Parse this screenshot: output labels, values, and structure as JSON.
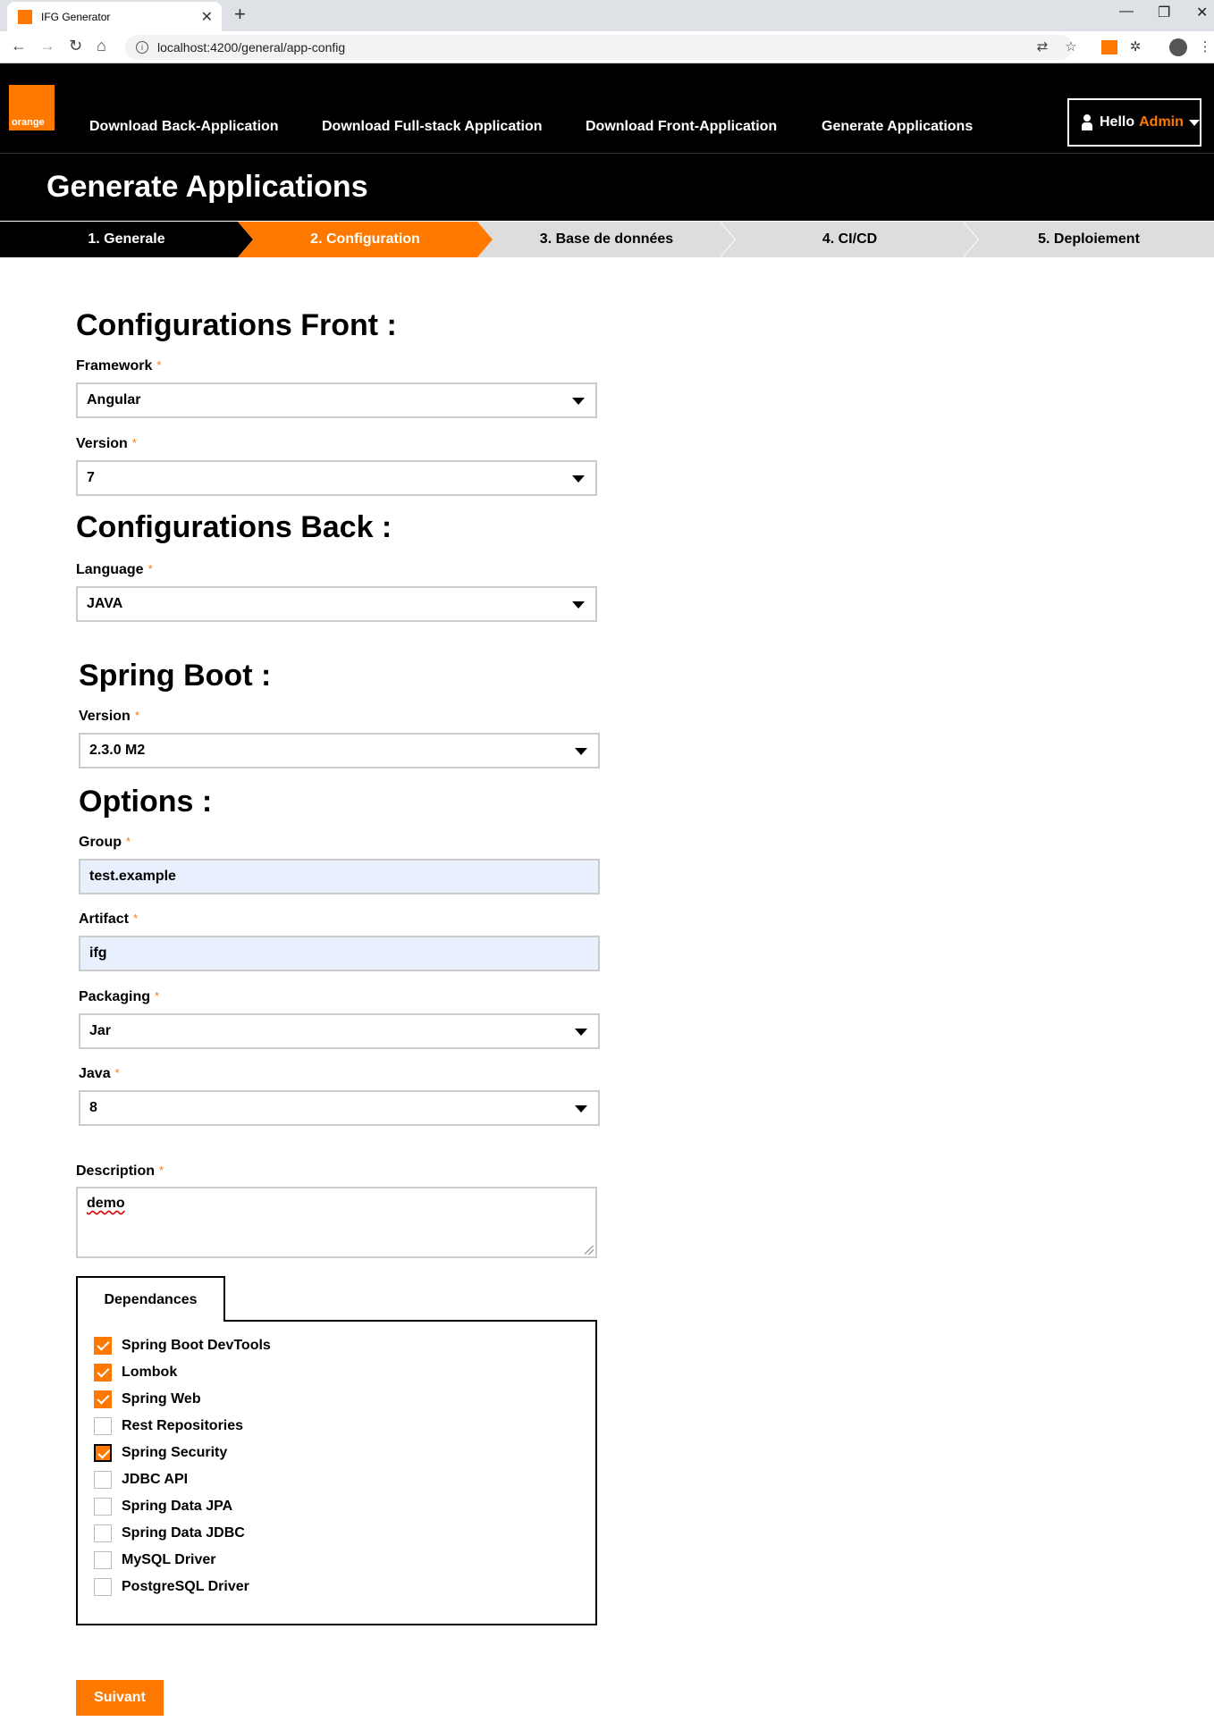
{
  "browser": {
    "tab_title": "IFG Generator",
    "url": "localhost:4200/general/app-config"
  },
  "header": {
    "logo_text": "orange",
    "nav": [
      "Download Back-Application",
      "Download Full-stack Application",
      "Download Front-Application",
      "Generate Applications"
    ],
    "user": {
      "greeting": "Hello",
      "name": "Admin"
    },
    "page_title": "Generate Applications"
  },
  "stepper": {
    "steps": [
      "1. Generale",
      "2. Configuration",
      "3. Base de données",
      "4. CI/CD",
      "5. Deploiement"
    ],
    "active_index": 1,
    "colors": {
      "done": "#000000",
      "active": "#ff7900",
      "pending": "#dddddd"
    }
  },
  "front": {
    "title": "Configurations Front :",
    "framework_label": "Framework",
    "framework_value": "Angular",
    "version_label": "Version",
    "version_value": "7"
  },
  "back": {
    "title": "Configurations Back :",
    "language_label": "Language",
    "language_value": "JAVA"
  },
  "spring": {
    "title": "Spring Boot :",
    "version_label": "Version",
    "version_value": "2.3.0 M2"
  },
  "options": {
    "title": "Options :",
    "group_label": "Group",
    "group_value": "test.example",
    "artifact_label": "Artifact",
    "artifact_value": "ifg",
    "packaging_label": "Packaging",
    "packaging_value": "Jar",
    "java_label": "Java",
    "java_value": "8",
    "description_label": "Description",
    "description_value": "demo"
  },
  "dependencies": {
    "tab_label": "Dependances",
    "items": [
      {
        "label": "Spring Boot DevTools",
        "checked": true
      },
      {
        "label": "Lombok",
        "checked": true
      },
      {
        "label": "Spring Web",
        "checked": true
      },
      {
        "label": "Rest Repositories",
        "checked": false
      },
      {
        "label": "Spring Security",
        "checked": true
      },
      {
        "label": "JDBC API",
        "checked": false
      },
      {
        "label": "Spring Data JPA",
        "checked": false
      },
      {
        "label": "Spring Data JDBC",
        "checked": false
      },
      {
        "label": "MySQL Driver",
        "checked": false
      },
      {
        "label": "PostgreSQL Driver",
        "checked": false
      }
    ]
  },
  "actions": {
    "next_label": "Suivant"
  },
  "colors": {
    "accent": "#ff7900",
    "header_bg": "#000000",
    "autofill_bg": "#e8f0fe"
  }
}
